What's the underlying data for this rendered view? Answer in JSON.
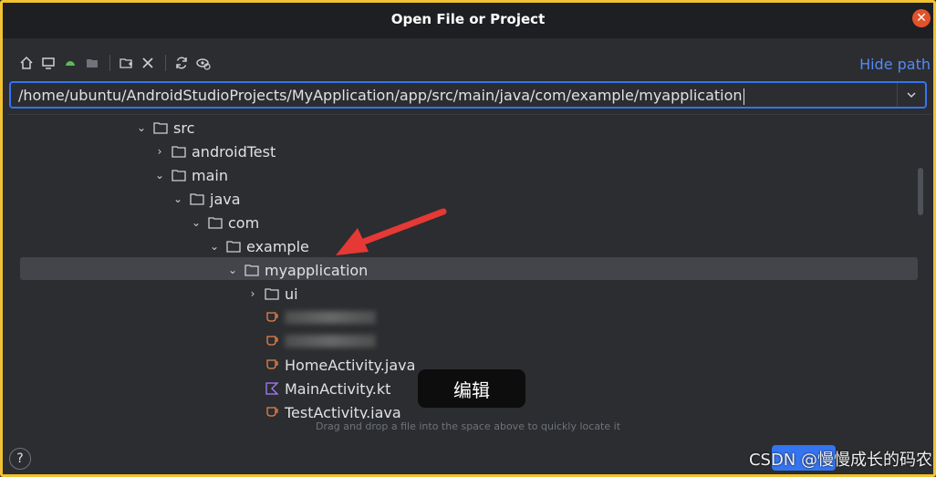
{
  "window": {
    "title": "Open File or Project",
    "close_icon": "close-icon"
  },
  "toolbar": {
    "icons": [
      "home-icon",
      "desktop-icon",
      "android-icon",
      "project-folder-icon",
      "new-folder-icon",
      "delete-icon",
      "refresh-icon",
      "show-hidden-icon"
    ],
    "hide_path_label": "Hide path"
  },
  "path": {
    "value": "/home/ubuntu/AndroidStudioProjects/MyApplication/app/src/main/java/com/example/myapplication"
  },
  "tree": {
    "items": [
      {
        "label": "src",
        "expanded": true,
        "type": "folder"
      },
      {
        "label": "androidTest",
        "expanded": false,
        "type": "folder"
      },
      {
        "label": "main",
        "expanded": true,
        "type": "folder"
      },
      {
        "label": "java",
        "expanded": true,
        "type": "folder"
      },
      {
        "label": "com",
        "expanded": true,
        "type": "folder"
      },
      {
        "label": "example",
        "expanded": true,
        "type": "folder"
      },
      {
        "label": "myapplication",
        "expanded": true,
        "type": "folder",
        "selected": true
      },
      {
        "label": "ui",
        "expanded": false,
        "type": "folder"
      },
      {
        "label": "HomeActivity.java",
        "type": "java-file"
      },
      {
        "label": "MainActivity.kt",
        "type": "kotlin-file"
      },
      {
        "label": "TestActivity.java",
        "type": "java-file"
      }
    ]
  },
  "tooltip": {
    "text": "编辑"
  },
  "hint": "Drag and drop a file into the space above to quickly locate it",
  "help_label": "?",
  "watermark": "CSDN @慢慢成长的码农",
  "colors": {
    "accent": "#3574f0",
    "link": "#548af7",
    "background": "#2b2d30",
    "arrow": "#e53935"
  }
}
